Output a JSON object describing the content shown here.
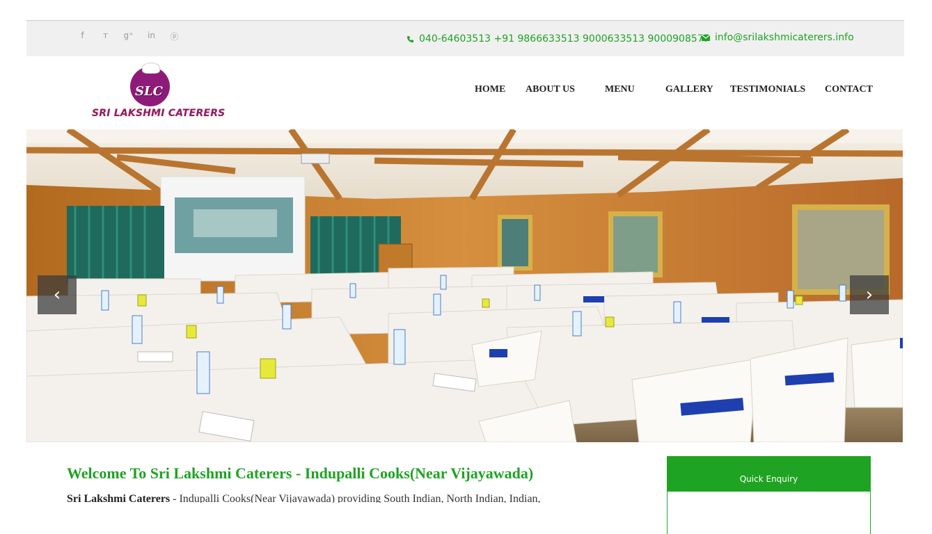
{
  "topbar": {
    "social": [
      {
        "icon": "facebook-icon",
        "glyph": "f"
      },
      {
        "icon": "twitter-icon",
        "glyph": "ᴛ"
      },
      {
        "icon": "google-plus-icon",
        "glyph": "g⁺"
      },
      {
        "icon": "linkedin-icon",
        "glyph": "in"
      },
      {
        "icon": "pinterest-icon",
        "glyph": "ⓟ"
      }
    ],
    "phone": "040-64603513 +91 9866633513  9000633513  9000908577",
    "email": "info@srilakshmicaterers.info"
  },
  "logo": {
    "initials": "SLC",
    "name": "SRI LAKSHMI CATERERS"
  },
  "nav": {
    "items": [
      "HOME",
      "ABOUT US",
      "MENU",
      "GALLERY",
      "TESTIMONIALS",
      "CONTACT"
    ]
  },
  "slider": {
    "prev_glyph": "‹",
    "next_glyph": "›"
  },
  "welcome": {
    "title": "Welcome To Sri Lakshmi Caterers - Indupalli Cooks(Near Vijayawada)",
    "bold": "Sri Lakshmi Caterers",
    "text": " - Indupalli Cooks(Near Vijayawada) providing South Indian, North Indian, Indian,"
  },
  "enquiry": {
    "title": "Quick Enquiry"
  },
  "colors": {
    "accent_green": "#1fa323",
    "brand_purple": "#8e1b7a"
  }
}
